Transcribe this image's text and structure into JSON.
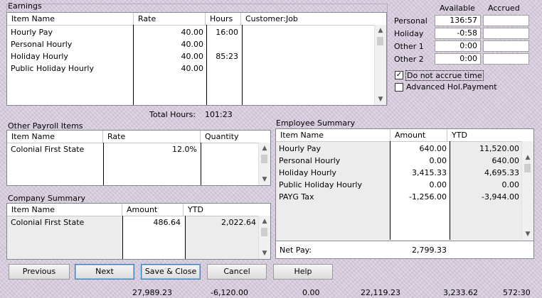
{
  "earnings": {
    "title": "Earnings",
    "columns": [
      "Item Name",
      "Rate",
      "Hours",
      "Customer:Job"
    ],
    "rows": [
      {
        "name": "Hourly Pay",
        "rate": "40.00",
        "hours": "16:00"
      },
      {
        "name": "Personal Hourly",
        "rate": "40.00",
        "hours": ""
      },
      {
        "name": "Holiday Hourly",
        "rate": "40.00",
        "hours": "85:23"
      },
      {
        "name": "Public Holiday Hourly",
        "rate": "40.00",
        "hours": ""
      }
    ],
    "total_hours_label": "Total Hours:",
    "total_hours_value": "101:23"
  },
  "accruals": {
    "available_label": "Available",
    "accrued_label": "Accrued",
    "rows": [
      {
        "label": "Personal",
        "available": "136:57",
        "accrued": ""
      },
      {
        "label": "Holiday",
        "available": "-0:58",
        "accrued": ""
      },
      {
        "label": "Other 1",
        "available": "0:00",
        "accrued": ""
      },
      {
        "label": "Other 2",
        "available": "0:00",
        "accrued": ""
      }
    ],
    "do_not_accrue_label": "Do not accrue time",
    "do_not_accrue_checked": true,
    "advanced_hol_label": "Advanced Hol.Payment",
    "advanced_hol_checked": false
  },
  "other_payroll": {
    "title": "Other Payroll Items",
    "columns": [
      "Item Name",
      "Rate",
      "Quantity"
    ],
    "rows": [
      {
        "name": "Colonial First State",
        "rate": "12.0%",
        "quantity": ""
      }
    ]
  },
  "company_summary": {
    "title": "Company Summary",
    "columns": [
      "Item Name",
      "Amount",
      "YTD"
    ],
    "rows": [
      {
        "name": "Colonial First State",
        "amount": "486.64",
        "ytd": "2,022.64"
      }
    ]
  },
  "employee_summary": {
    "title": "Employee Summary",
    "columns": [
      "Item Name",
      "Amount",
      "YTD"
    ],
    "rows": [
      {
        "name": "Hourly Pay",
        "amount": "640.00",
        "ytd": "11,520.00"
      },
      {
        "name": "Personal Hourly",
        "amount": "0.00",
        "ytd": "640.00"
      },
      {
        "name": "Holiday Hourly",
        "amount": "3,415.33",
        "ytd": "4,695.33"
      },
      {
        "name": "Public Holiday Hourly",
        "amount": "0.00",
        "ytd": "0.00"
      },
      {
        "name": "PAYG Tax",
        "amount": "-1,256.00",
        "ytd": "-3,944.00"
      }
    ],
    "net_pay_label": "Net Pay:",
    "net_pay_value": "2,799.33"
  },
  "buttons": {
    "previous": "Previous",
    "next": "Next",
    "save_close": "Save & Close",
    "cancel": "Cancel",
    "help": "Help"
  },
  "footer": [
    "27,989.23",
    "-6,120.00",
    "0.00",
    "22,119.23",
    "3,233.62",
    "572:30"
  ],
  "icons": {
    "scroll_up": "scroll-up-arrow-icon",
    "scroll_down": "scroll-down-arrow-icon",
    "check": "checkmark-icon"
  }
}
